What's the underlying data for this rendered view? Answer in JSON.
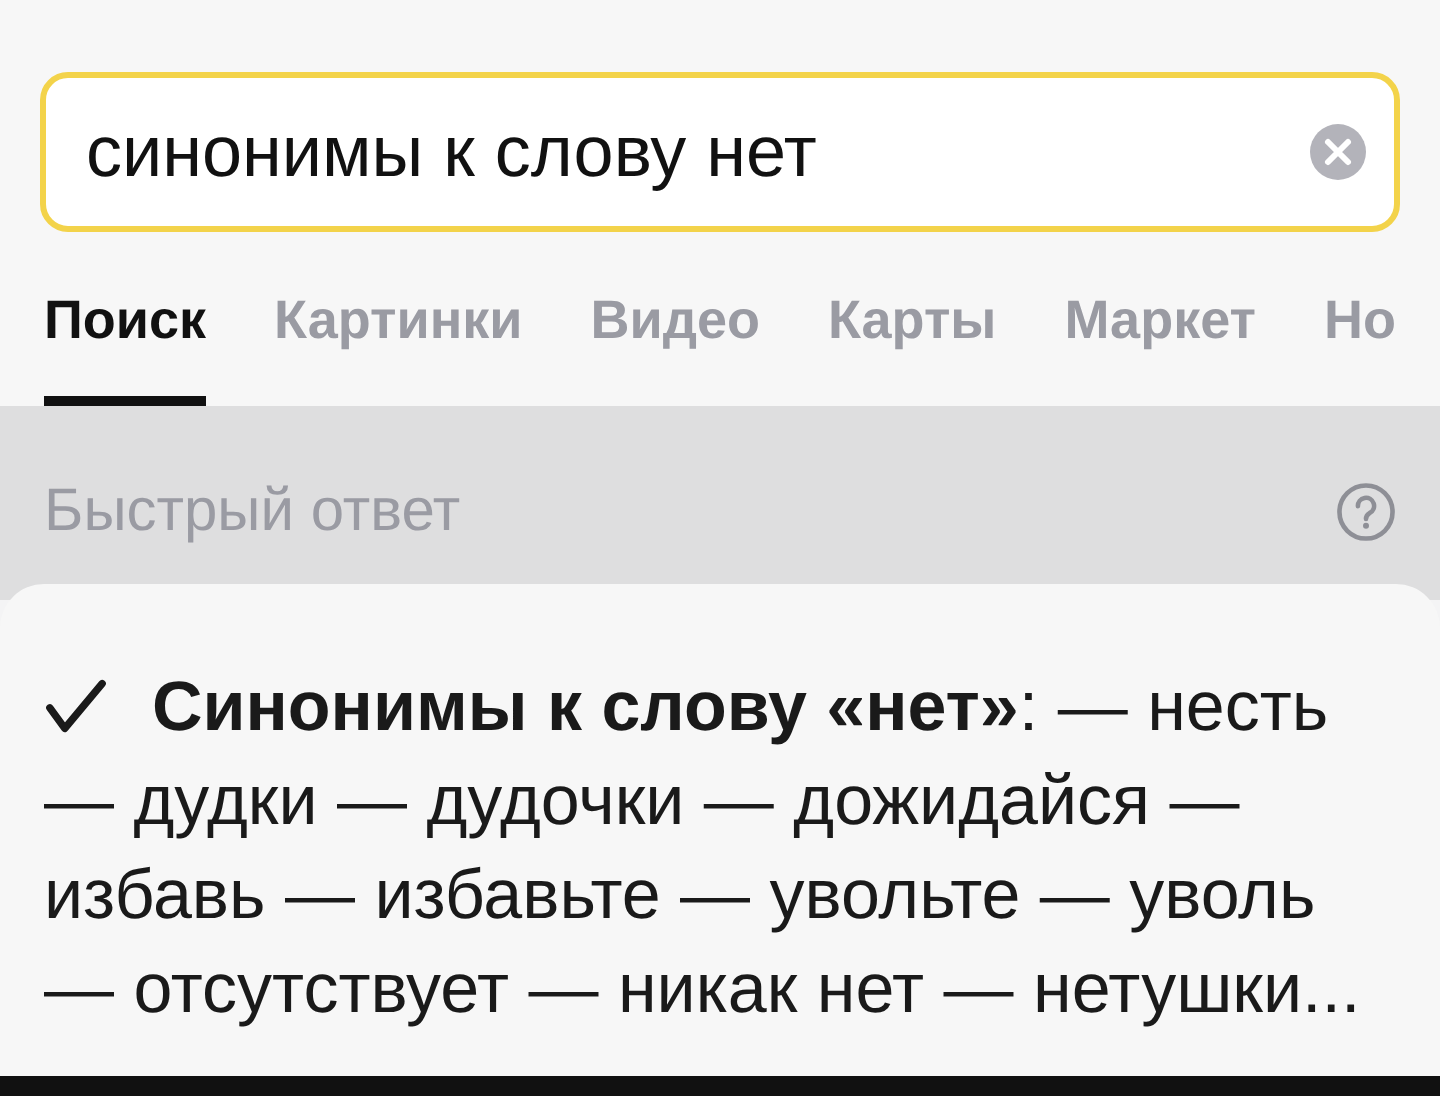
{
  "search": {
    "value": "синонимы к слову нет"
  },
  "tabs": [
    {
      "label": "Поиск",
      "selected": true
    },
    {
      "label": "Картинки",
      "selected": false
    },
    {
      "label": "Видео",
      "selected": false
    },
    {
      "label": "Карты",
      "selected": false
    },
    {
      "label": "Маркет",
      "selected": false
    },
    {
      "label": "Но",
      "selected": false
    }
  ],
  "quick_answer": {
    "title": "Быстрый ответ",
    "text": "**Синонимы к слову «нет»**: — несть — дудки — дудочки — дожидайся — избавь — избавьте — увольте — уволь — отсутствует — никак нет — нетушки..."
  }
}
